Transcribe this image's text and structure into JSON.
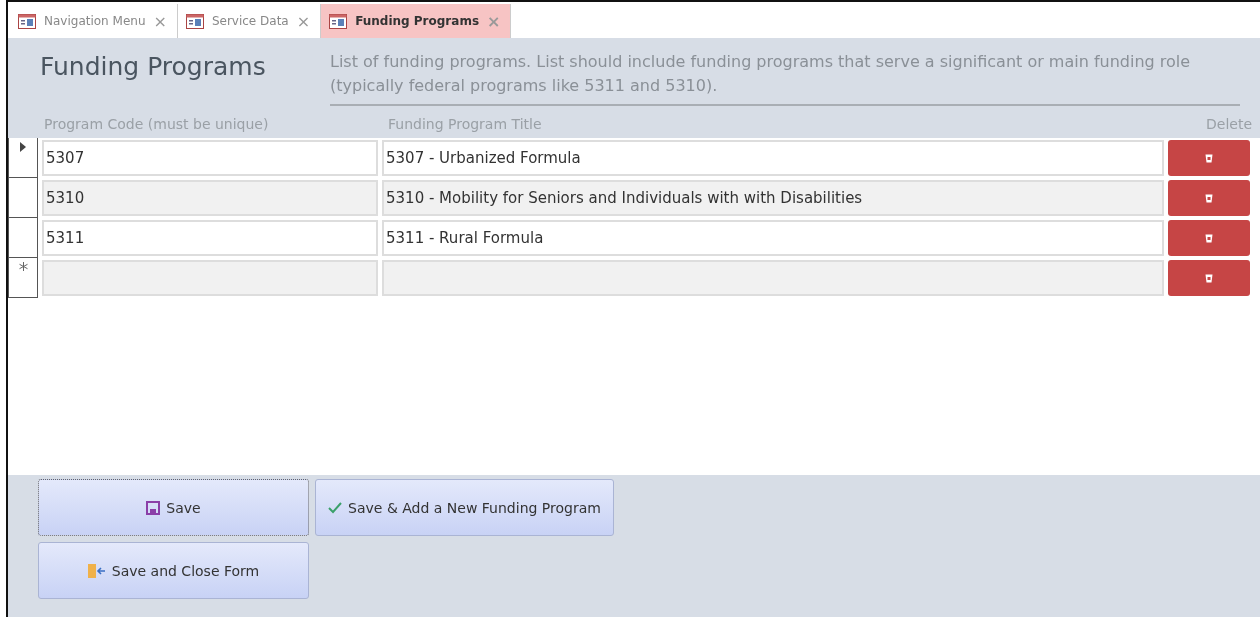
{
  "tabs": [
    {
      "label": "Navigation Menu",
      "close": "×",
      "selected": false
    },
    {
      "label": "Service Data",
      "close": "×",
      "selected": false
    },
    {
      "label": "Funding Programs",
      "close": "×",
      "selected": true
    }
  ],
  "form": {
    "title": "Funding Programs",
    "description": "List of funding programs. List should include funding programs that serve a significant or main funding role (typically federal programs like 5311 and 5310)."
  },
  "table": {
    "columns": [
      "Program Code (must be unique)",
      "Funding Program Title",
      "Delete"
    ],
    "rows": [
      {
        "kind": "current",
        "code": "5307",
        "title": "5307 - Urbanized Formula"
      },
      {
        "kind": "normal",
        "code": "5310",
        "title": "5310 - Mobility for Seniors and Individuals with with Disabilities"
      },
      {
        "kind": "normal",
        "code": "5311",
        "title": "5311 - Rural Formula"
      },
      {
        "kind": "new",
        "code": "",
        "title": ""
      }
    ]
  },
  "buttons": [
    {
      "kind": "save",
      "label": "Save",
      "focused": true
    },
    {
      "kind": "add",
      "label": "Save & Add a New Funding Program",
      "focused": false
    },
    {
      "kind": "close",
      "label": "Save and Close Form",
      "focused": false
    }
  ]
}
